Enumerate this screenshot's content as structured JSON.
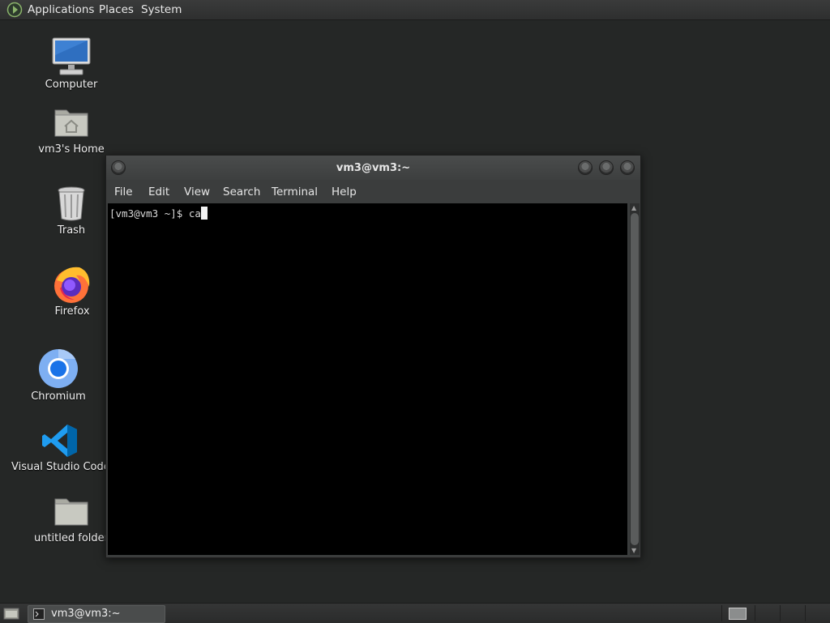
{
  "top_panel": {
    "menus": [
      "Applications",
      "Places",
      "System"
    ]
  },
  "desktop": {
    "icons": [
      {
        "label": "Computer",
        "icon": "computer-icon"
      },
      {
        "label": "vm3's Home",
        "icon": "home-folder-icon"
      },
      {
        "label": "Trash",
        "icon": "trash-icon"
      },
      {
        "label": "Firefox",
        "icon": "firefox-icon"
      },
      {
        "label": "Chromium",
        "icon": "chromium-icon"
      },
      {
        "label": "Visual Studio Code",
        "icon": "vscode-icon"
      },
      {
        "label": "untitled folder",
        "icon": "folder-icon"
      }
    ]
  },
  "terminal": {
    "title": "vm3@vm3:~",
    "menus": [
      "File",
      "Edit",
      "View",
      "Search",
      "Terminal",
      "Help"
    ],
    "prompt": "[vm3@vm3 ~]$ ",
    "input": "ca"
  },
  "taskbar": {
    "task_label": "vm3@vm3:~"
  },
  "colors": {
    "desktop_bg": "#252726",
    "panel_bg": "#2e2f2f",
    "window_bg": "#3b3d3d",
    "terminal_bg": "#000000"
  }
}
